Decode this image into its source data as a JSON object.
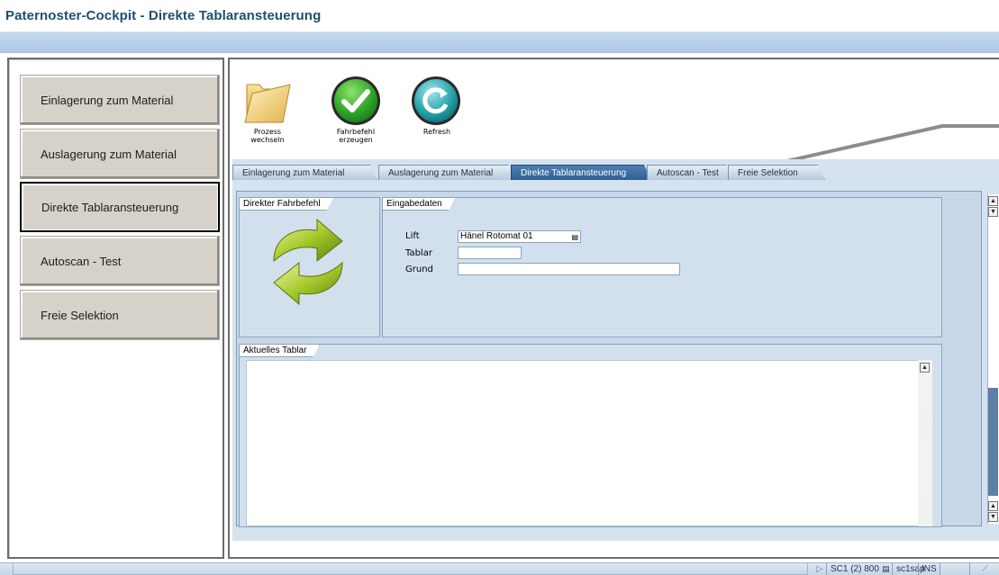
{
  "window": {
    "title": "Paternoster-Cockpit - Direkte Tablaransteuerung"
  },
  "nav": {
    "items": [
      {
        "label": "Einlagerung zum Material"
      },
      {
        "label": "Auslagerung zum Material"
      },
      {
        "label": "Direkte Tablaransteuerung"
      },
      {
        "label": "Autoscan - Test"
      },
      {
        "label": "Freie Selektion"
      }
    ],
    "active_index": 2
  },
  "toolbar": {
    "process_change_label": "Prozess wechseln",
    "create_order_line1": "Fahrbefehl",
    "create_order_line2": "erzeugen",
    "refresh_label": "Refresh"
  },
  "tabs": [
    {
      "label": "Einlagerung zum Material"
    },
    {
      "label": "Auslagerung zum Material"
    },
    {
      "label": "Direkte Tablaransteuerung"
    },
    {
      "label": "Autoscan - Test"
    },
    {
      "label": "Freie Selektion"
    }
  ],
  "groups": {
    "direct_order_title": "Direkter Fahrbefehl",
    "input_title": "Eingabedaten",
    "current_tray_title": "Aktuelles Tablar"
  },
  "form": {
    "lift_label": "Lift",
    "lift_value": "Hänel Rotomat 01",
    "tray_label": "Tablar",
    "tray_value": "",
    "reason_label": "Grund",
    "reason_value": ""
  },
  "status": {
    "system": "SC1 (2) 800",
    "server": "sc1sap",
    "mode": "INS"
  },
  "colors": {
    "title": "#1f4e6e",
    "tab_active": "#2f5f93",
    "panel": "#c8d8e8",
    "nav_button": "#d6d2ca"
  }
}
